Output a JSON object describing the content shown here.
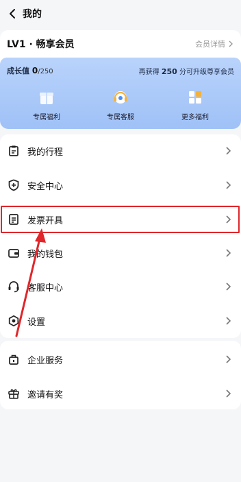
{
  "header": {
    "title": "我的"
  },
  "member": {
    "level_title": "LV1 · 畅享会员",
    "details_link": "会员详情",
    "growth_label": "成长值",
    "growth_value": "0",
    "growth_max": "/250",
    "upgrade_prefix": "再获得",
    "upgrade_points": "250",
    "upgrade_suffix": "分可升级尊享会员",
    "perks": [
      {
        "label": "专属福利",
        "icon": "gift-icon"
      },
      {
        "label": "专属客服",
        "icon": "headset-icon"
      },
      {
        "label": "更多福利",
        "icon": "grid-icon"
      }
    ]
  },
  "menu": {
    "items": [
      {
        "label": "我的行程",
        "icon": "itinerary-icon"
      },
      {
        "label": "安全中心",
        "icon": "shield-icon"
      },
      {
        "label": "发票开具",
        "icon": "invoice-icon"
      },
      {
        "label": "我的钱包",
        "icon": "wallet-icon"
      },
      {
        "label": "客服中心",
        "icon": "customer-service-icon"
      },
      {
        "label": "设置",
        "icon": "settings-icon"
      }
    ],
    "items2": [
      {
        "label": "企业服务",
        "icon": "enterprise-icon"
      },
      {
        "label": "邀请有奖",
        "icon": "invite-reward-icon"
      }
    ]
  },
  "annotation": {
    "color": "#e0262a",
    "highlighted_item": "发票开具"
  },
  "colors": {
    "accent_panel": "#b9d3fb",
    "background": "#f5f6f8"
  }
}
